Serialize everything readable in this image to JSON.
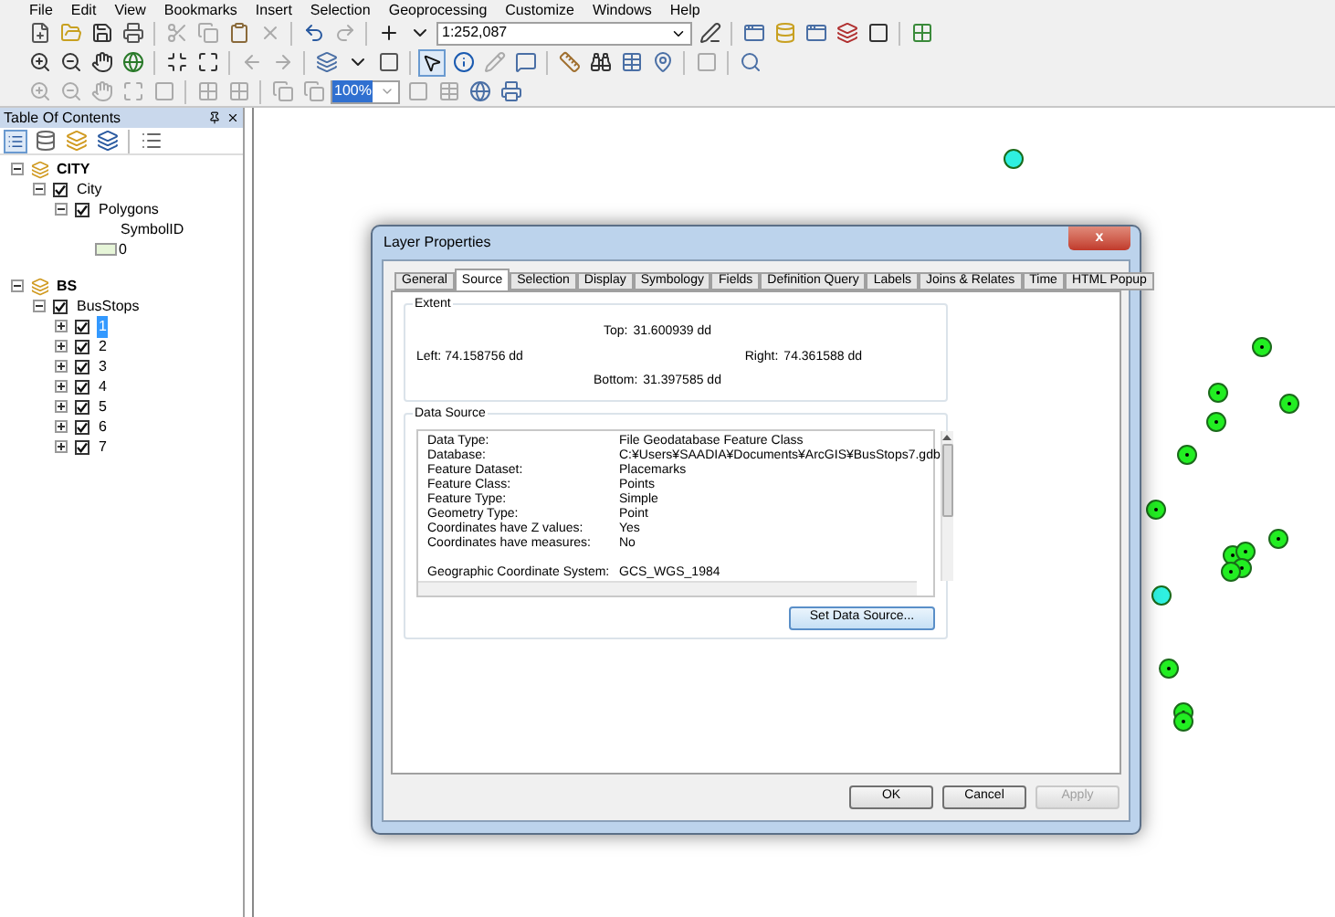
{
  "menu": [
    "File",
    "Edit",
    "View",
    "Bookmarks",
    "Insert",
    "Selection",
    "Geoprocessing",
    "Customize",
    "Windows",
    "Help"
  ],
  "toolbar": {
    "scale": "1:252,087",
    "zoom": "100%"
  },
  "toc": {
    "title": "Table Of Contents",
    "tree": [
      {
        "label": "CITY",
        "kind": "group",
        "expanded": true,
        "children": [
          {
            "label": "City",
            "kind": "layer",
            "checked": true,
            "expanded": true,
            "selected": false,
            "children": [
              {
                "label": "Polygons",
                "kind": "layer",
                "checked": true,
                "expanded": true,
                "selected": false,
                "children": [
                  {
                    "label": "SymbolID",
                    "kind": "heading"
                  },
                  {
                    "label": "0",
                    "kind": "legend",
                    "color": "#e6f5d8"
                  }
                ]
              }
            ]
          }
        ]
      },
      {
        "label": "BS",
        "kind": "group",
        "expanded": true,
        "children": [
          {
            "label": "BusStops",
            "kind": "layer",
            "checked": true,
            "expanded": true,
            "selected": false,
            "children": [
              {
                "label": "1",
                "kind": "layer",
                "checked": true,
                "expanded": false,
                "selected": true
              },
              {
                "label": "2",
                "kind": "layer",
                "checked": true,
                "expanded": false,
                "selected": false
              },
              {
                "label": "3",
                "kind": "layer",
                "checked": true,
                "expanded": false,
                "selected": false
              },
              {
                "label": "4",
                "kind": "layer",
                "checked": true,
                "expanded": false,
                "selected": false
              },
              {
                "label": "5",
                "kind": "layer",
                "checked": true,
                "expanded": false,
                "selected": false
              },
              {
                "label": "6",
                "kind": "layer",
                "checked": true,
                "expanded": false,
                "selected": false
              },
              {
                "label": "7",
                "kind": "layer",
                "checked": true,
                "expanded": false,
                "selected": false
              }
            ]
          }
        ]
      }
    ]
  },
  "dialog": {
    "title": "Layer Properties",
    "close": "x",
    "tabs": [
      {
        "label": "General",
        "selected": false
      },
      {
        "label": "Source",
        "selected": true
      },
      {
        "label": "Selection",
        "selected": false
      },
      {
        "label": "Display",
        "selected": false
      },
      {
        "label": "Symbology",
        "selected": false
      },
      {
        "label": "Fields",
        "selected": false
      },
      {
        "label": "Definition Query",
        "selected": false
      },
      {
        "label": "Labels",
        "selected": false
      },
      {
        "label": "Joins & Relates",
        "selected": false
      },
      {
        "label": "Time",
        "selected": false
      },
      {
        "label": "HTML Popup",
        "selected": false
      }
    ],
    "extent": {
      "title": "Extent",
      "top_label": "Top:",
      "top": "31.600939 dd",
      "left_label": "Left:",
      "left": "74.158756 dd",
      "right_label": "Right:",
      "right": "74.361588 dd",
      "bottom_label": "Bottom:",
      "bottom": "31.397585 dd"
    },
    "data_source": {
      "title": "Data Source",
      "sections": [
        {
          "rows": [
            {
              "label": "Data Type:",
              "value": "File Geodatabase Feature Class"
            },
            {
              "label": "Database:",
              "value": "C:¥Users¥SAADIA¥Documents¥ArcGIS¥BusStops7.gdb"
            },
            {
              "label": "Feature Dataset:",
              "value": "Placemarks"
            },
            {
              "label": "Feature Class:",
              "value": "Points"
            },
            {
              "label": "Feature Type:",
              "value": "Simple"
            },
            {
              "label": "Geometry Type:",
              "value": "Point"
            },
            {
              "label": "Coordinates have Z values:",
              "value": "Yes"
            },
            {
              "label": "Coordinates have measures:",
              "value": "No"
            }
          ]
        },
        {
          "rows": [
            {
              "label": "Geographic Coordinate System:",
              "value": "GCS_WGS_1984"
            }
          ]
        }
      ],
      "button": "Set Data Source..."
    },
    "buttons": [
      {
        "label": "OK",
        "disabled": false
      },
      {
        "label": "Cancel",
        "disabled": false
      },
      {
        "label": "Apply",
        "disabled": true
      }
    ]
  }
}
